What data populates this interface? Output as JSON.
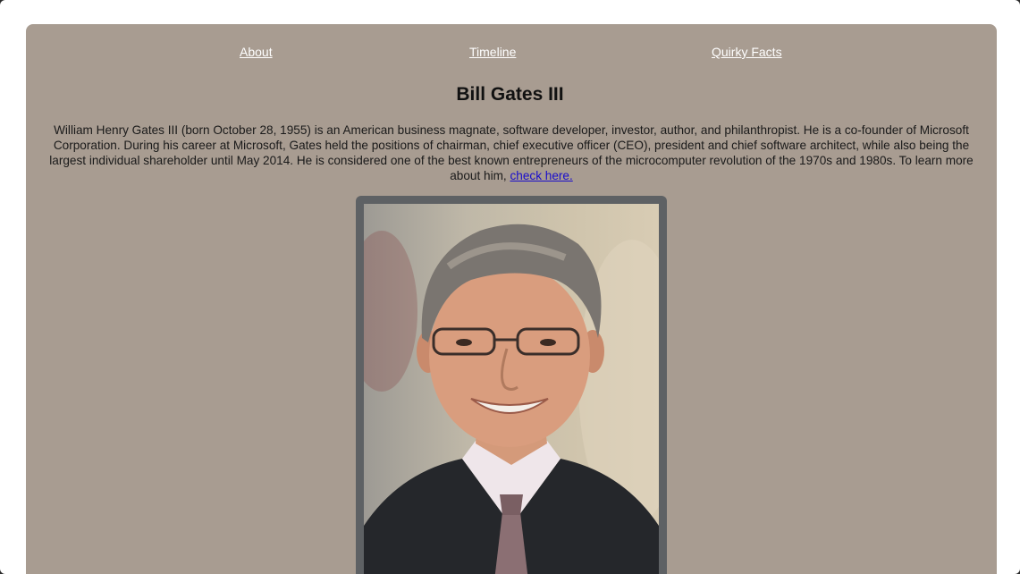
{
  "nav": {
    "about": "About",
    "timeline": "Timeline",
    "quirky_facts": "Quirky Facts"
  },
  "page_title": "Bill Gates III",
  "bio": {
    "text": "William Henry Gates III (born October 28, 1955) is an American business magnate, software developer, investor, author, and philanthropist. He is a co-founder of Microsoft Corporation. During his career at Microsoft, Gates held the positions of chairman, chief executive officer (CEO), president and chief software architect, while also being the largest individual shareholder until May 2014. He is considered one of the best known entrepreneurs of the microcomputer revolution of the 1970s and 1980s. To learn more about him,",
    "link_label": "check here."
  },
  "colors": {
    "card_background": "#a89c91",
    "frame": "#5e6164",
    "nav_link": "#ffffff",
    "body_link": "#1a0dcc"
  }
}
